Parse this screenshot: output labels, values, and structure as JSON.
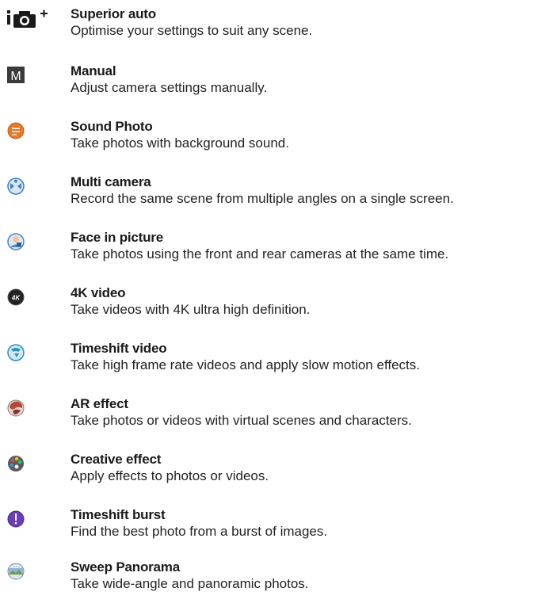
{
  "modes": [
    {
      "icon": "superior-auto-camera-icon",
      "title": "Superior auto",
      "description": "Optimise your settings to suit any scene."
    },
    {
      "icon": "manual-m-icon",
      "title": "Manual",
      "description": "Adjust camera settings manually."
    },
    {
      "icon": "sound-photo-icon",
      "title": "Sound Photo",
      "description": "Take photos with background sound."
    },
    {
      "icon": "multi-camera-icon",
      "title": "Multi camera",
      "description": "Record the same scene from multiple angles on a single screen."
    },
    {
      "icon": "face-in-picture-icon",
      "title": "Face in picture",
      "description": "Take photos using the front and rear cameras at the same time."
    },
    {
      "icon": "4k-video-icon",
      "title": "4K video",
      "description": "Take videos with 4K ultra high definition."
    },
    {
      "icon": "timeshift-video-icon",
      "title": "Timeshift video",
      "description": "Take high frame rate videos and apply slow motion effects."
    },
    {
      "icon": "ar-effect-icon",
      "title": "AR effect",
      "description": "Take photos or videos with virtual scenes and characters."
    },
    {
      "icon": "creative-effect-icon",
      "title": "Creative effect",
      "description": "Apply effects to photos or videos."
    },
    {
      "icon": "timeshift-burst-icon",
      "title": "Timeshift burst",
      "description": "Find the best photo from a burst of images."
    },
    {
      "icon": "sweep-panorama-icon",
      "title": "Sweep Panorama",
      "description": "Take wide-angle and panoramic photos."
    }
  ],
  "icon_labels": {
    "manual": "M",
    "fourk": "4K"
  },
  "colors": {
    "text": "#1a1a1a",
    "sound_photo": "#e8782a",
    "multi_camera": "#3f7fc4",
    "face_in_picture": "#4a86c9",
    "four_k": "#222222",
    "timeshift_video": "#2d8fc4",
    "ar_effect": "#b5483a",
    "creative_effect": "#5a5a5a",
    "timeshift_burst": "#6a3fb5",
    "sweep_panorama": "#6f9c4a"
  }
}
